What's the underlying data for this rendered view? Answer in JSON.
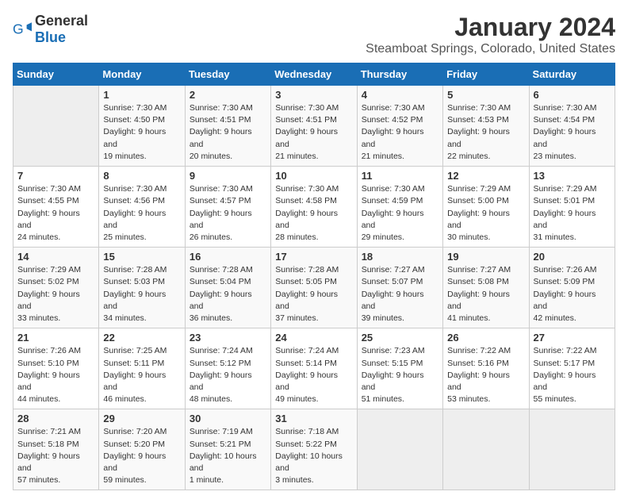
{
  "header": {
    "logo_general": "General",
    "logo_blue": "Blue",
    "title": "January 2024",
    "subtitle": "Steamboat Springs, Colorado, United States"
  },
  "days_of_week": [
    "Sunday",
    "Monday",
    "Tuesday",
    "Wednesday",
    "Thursday",
    "Friday",
    "Saturday"
  ],
  "weeks": [
    [
      {
        "day": "",
        "empty": true
      },
      {
        "day": "1",
        "sunrise": "7:30 AM",
        "sunset": "4:50 PM",
        "daylight": "9 hours and 19 minutes."
      },
      {
        "day": "2",
        "sunrise": "7:30 AM",
        "sunset": "4:51 PM",
        "daylight": "9 hours and 20 minutes."
      },
      {
        "day": "3",
        "sunrise": "7:30 AM",
        "sunset": "4:51 PM",
        "daylight": "9 hours and 21 minutes."
      },
      {
        "day": "4",
        "sunrise": "7:30 AM",
        "sunset": "4:52 PM",
        "daylight": "9 hours and 21 minutes."
      },
      {
        "day": "5",
        "sunrise": "7:30 AM",
        "sunset": "4:53 PM",
        "daylight": "9 hours and 22 minutes."
      },
      {
        "day": "6",
        "sunrise": "7:30 AM",
        "sunset": "4:54 PM",
        "daylight": "9 hours and 23 minutes."
      }
    ],
    [
      {
        "day": "7",
        "sunrise": "7:30 AM",
        "sunset": "4:55 PM",
        "daylight": "9 hours and 24 minutes."
      },
      {
        "day": "8",
        "sunrise": "7:30 AM",
        "sunset": "4:56 PM",
        "daylight": "9 hours and 25 minutes."
      },
      {
        "day": "9",
        "sunrise": "7:30 AM",
        "sunset": "4:57 PM",
        "daylight": "9 hours and 26 minutes."
      },
      {
        "day": "10",
        "sunrise": "7:30 AM",
        "sunset": "4:58 PM",
        "daylight": "9 hours and 28 minutes."
      },
      {
        "day": "11",
        "sunrise": "7:30 AM",
        "sunset": "4:59 PM",
        "daylight": "9 hours and 29 minutes."
      },
      {
        "day": "12",
        "sunrise": "7:29 AM",
        "sunset": "5:00 PM",
        "daylight": "9 hours and 30 minutes."
      },
      {
        "day": "13",
        "sunrise": "7:29 AM",
        "sunset": "5:01 PM",
        "daylight": "9 hours and 31 minutes."
      }
    ],
    [
      {
        "day": "14",
        "sunrise": "7:29 AM",
        "sunset": "5:02 PM",
        "daylight": "9 hours and 33 minutes."
      },
      {
        "day": "15",
        "sunrise": "7:28 AM",
        "sunset": "5:03 PM",
        "daylight": "9 hours and 34 minutes."
      },
      {
        "day": "16",
        "sunrise": "7:28 AM",
        "sunset": "5:04 PM",
        "daylight": "9 hours and 36 minutes."
      },
      {
        "day": "17",
        "sunrise": "7:28 AM",
        "sunset": "5:05 PM",
        "daylight": "9 hours and 37 minutes."
      },
      {
        "day": "18",
        "sunrise": "7:27 AM",
        "sunset": "5:07 PM",
        "daylight": "9 hours and 39 minutes."
      },
      {
        "day": "19",
        "sunrise": "7:27 AM",
        "sunset": "5:08 PM",
        "daylight": "9 hours and 41 minutes."
      },
      {
        "day": "20",
        "sunrise": "7:26 AM",
        "sunset": "5:09 PM",
        "daylight": "9 hours and 42 minutes."
      }
    ],
    [
      {
        "day": "21",
        "sunrise": "7:26 AM",
        "sunset": "5:10 PM",
        "daylight": "9 hours and 44 minutes."
      },
      {
        "day": "22",
        "sunrise": "7:25 AM",
        "sunset": "5:11 PM",
        "daylight": "9 hours and 46 minutes."
      },
      {
        "day": "23",
        "sunrise": "7:24 AM",
        "sunset": "5:12 PM",
        "daylight": "9 hours and 48 minutes."
      },
      {
        "day": "24",
        "sunrise": "7:24 AM",
        "sunset": "5:14 PM",
        "daylight": "9 hours and 49 minutes."
      },
      {
        "day": "25",
        "sunrise": "7:23 AM",
        "sunset": "5:15 PM",
        "daylight": "9 hours and 51 minutes."
      },
      {
        "day": "26",
        "sunrise": "7:22 AM",
        "sunset": "5:16 PM",
        "daylight": "9 hours and 53 minutes."
      },
      {
        "day": "27",
        "sunrise": "7:22 AM",
        "sunset": "5:17 PM",
        "daylight": "9 hours and 55 minutes."
      }
    ],
    [
      {
        "day": "28",
        "sunrise": "7:21 AM",
        "sunset": "5:18 PM",
        "daylight": "9 hours and 57 minutes."
      },
      {
        "day": "29",
        "sunrise": "7:20 AM",
        "sunset": "5:20 PM",
        "daylight": "9 hours and 59 minutes."
      },
      {
        "day": "30",
        "sunrise": "7:19 AM",
        "sunset": "5:21 PM",
        "daylight": "10 hours and 1 minute."
      },
      {
        "day": "31",
        "sunrise": "7:18 AM",
        "sunset": "5:22 PM",
        "daylight": "10 hours and 3 minutes."
      },
      {
        "day": "",
        "empty": true
      },
      {
        "day": "",
        "empty": true
      },
      {
        "day": "",
        "empty": true
      }
    ]
  ]
}
